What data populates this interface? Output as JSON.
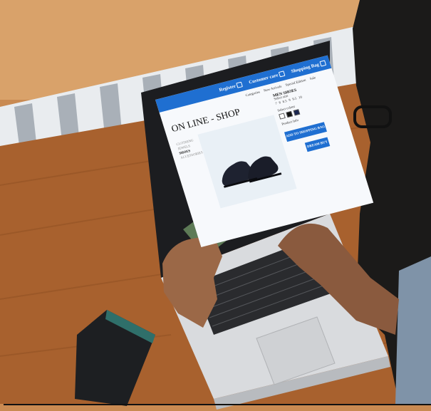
{
  "site": {
    "nav": [
      "Register",
      "Customer care",
      "Shopping Bag"
    ],
    "title": "ON LINE - SHOP",
    "menu": [
      "Categories",
      "New Arrivals",
      "Special Edition",
      "Sale"
    ],
    "categories": [
      "CLOTHING",
      "JEWELS",
      "SHOES",
      "ACCESSORIES"
    ],
    "active_category": "SHOES",
    "product_heading": "MEN SHOES",
    "size_label": "Select size",
    "sizes": [
      "7",
      "8",
      "8.5",
      "9",
      "9.5",
      "10"
    ],
    "colour_label": "Select colour",
    "product_info": "Product Info",
    "add_button": "ADD TO SHOPPING BAG",
    "buy_button": "DREAM BUY"
  },
  "colors": {
    "site_accent": "#1f6fd1",
    "table_wood": "#a8612e",
    "laptop_silver": "#d9dbde"
  },
  "icons": [
    "user-icon",
    "chat-icon",
    "bag-icon"
  ]
}
